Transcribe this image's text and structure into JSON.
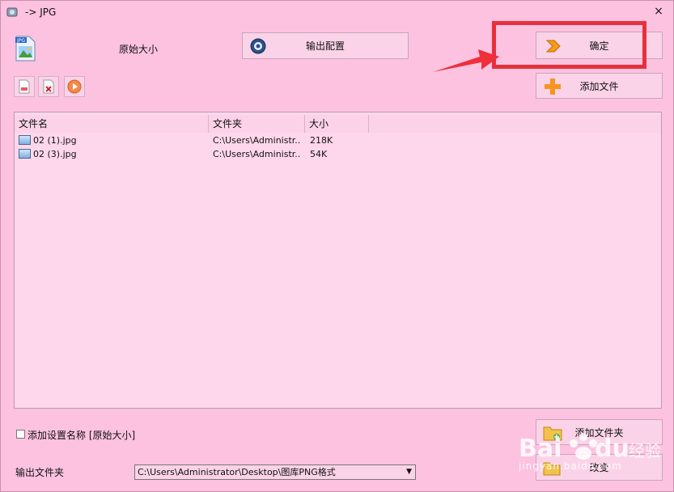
{
  "window": {
    "title": "-> JPG",
    "close_glyph": "×"
  },
  "top": {
    "size_label": "原始大小",
    "output_config_label": "输出配置",
    "confirm_label": "确定",
    "add_file_label": "添加文件"
  },
  "toolbar_icons": [
    "delete-file-icon",
    "remove-file-icon",
    "play-icon"
  ],
  "file_list": {
    "columns": [
      "文件名",
      "文件夹",
      "大小"
    ],
    "rows": [
      {
        "name": "02 (1).jpg",
        "folder": "C:\\Users\\Administr...",
        "size": "218K"
      },
      {
        "name": "02 (3).jpg",
        "folder": "C:\\Users\\Administr...",
        "size": "54K"
      }
    ]
  },
  "bottom": {
    "add_setting_name_label": "添加设置名称 [原始大小]",
    "add_setting_name_checked": false,
    "output_folder_label": "输出文件夹",
    "output_folder_value": "C:\\Users\\Administrator\\Desktop\\图库PNG格式",
    "add_folder_label": "添加文件夹",
    "change_label": "改变"
  },
  "watermark": {
    "brand": "Bai du 经验",
    "url": "jingyan.baidu.com"
  },
  "colors": {
    "window_bg": "#fcc2e0",
    "list_bg": "#ffd7ec",
    "highlight": "#e6313c",
    "arrow": "#ef2f3c"
  }
}
